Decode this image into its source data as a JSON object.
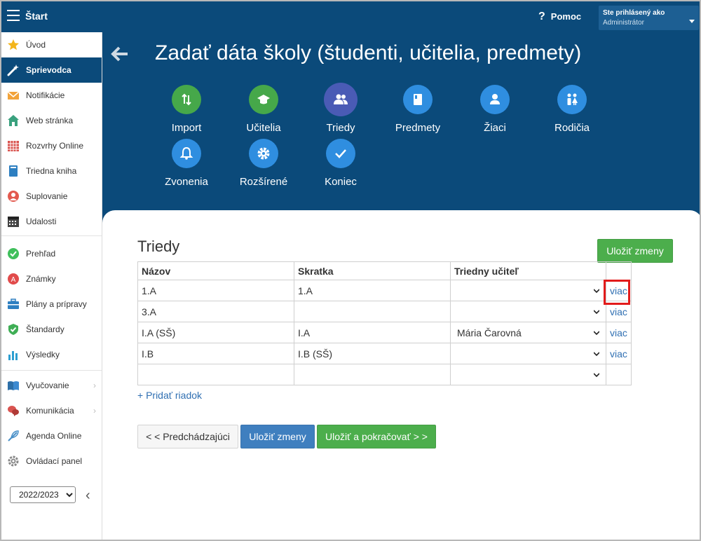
{
  "topbar": {
    "title": "Štart",
    "help_label": "Pomoc",
    "help_icon": "?",
    "user_line1": "Ste prihlásený ako",
    "user_line2": "Administrátor"
  },
  "sidebar": {
    "items": [
      {
        "label": "Úvod",
        "icon": "star-icon"
      },
      {
        "label": "Sprievodca",
        "icon": "magic-wand-icon"
      },
      {
        "label": "Notifikácie",
        "icon": "envelope-icon"
      },
      {
        "label": "Web stránka",
        "icon": "house-icon"
      },
      {
        "label": "Rozvrhy Online",
        "icon": "timetable-icon"
      },
      {
        "label": "Triedna kniha",
        "icon": "book-icon"
      },
      {
        "label": "Suplovanie",
        "icon": "person-icon"
      },
      {
        "label": "Udalosti",
        "icon": "calendar-icon"
      },
      {
        "label": "Prehľad",
        "icon": "check-circle-icon"
      },
      {
        "label": "Známky",
        "icon": "grade-icon"
      },
      {
        "label": "Plány a prípravy",
        "icon": "briefcase-icon"
      },
      {
        "label": "Štandardy",
        "icon": "shield-check-icon"
      },
      {
        "label": "Výsledky",
        "icon": "bar-chart-icon"
      },
      {
        "label": "Vyučovanie",
        "icon": "open-book-icon"
      },
      {
        "label": "Komunikácia",
        "icon": "chat-icon"
      },
      {
        "label": "Agenda Online",
        "icon": "feather-icon"
      },
      {
        "label": "Ovládací panel",
        "icon": "gear-icon"
      }
    ],
    "year": "2022/2023"
  },
  "header": {
    "title": "Zadať dáta školy (študenti, učitelia, predmety)"
  },
  "steps": [
    {
      "label": "Import",
      "icon": "import-arrows-icon"
    },
    {
      "label": "Učitelia",
      "icon": "graduation-cap-icon"
    },
    {
      "label": "Triedy",
      "icon": "group-icon"
    },
    {
      "label": "Predmety",
      "icon": "notebook-icon"
    },
    {
      "label": "Žiaci",
      "icon": "user-icon"
    },
    {
      "label": "Rodičia",
      "icon": "parents-icon"
    },
    {
      "label": "Zvonenia",
      "icon": "bell-icon"
    },
    {
      "label": "Rozšírené",
      "icon": "gear-icon"
    },
    {
      "label": "Koniec",
      "icon": "checkmark-icon"
    }
  ],
  "section": {
    "title": "Triedy",
    "save_top": "Uložiť zmeny",
    "columns": [
      "Názov",
      "Skratka",
      "Triedny učiteľ"
    ],
    "rows": [
      {
        "name": "1.A",
        "abbr": "1.A",
        "teacher": "",
        "more": "viac"
      },
      {
        "name": "3.A",
        "abbr": "",
        "teacher": "",
        "more": "viac"
      },
      {
        "name": "I.A (SŠ)",
        "abbr": "I.A",
        "teacher": "Mária Čarovná",
        "more": "viac"
      },
      {
        "name": "I.B",
        "abbr": "I.B (SŠ)",
        "teacher": "",
        "more": "viac"
      },
      {
        "name": "",
        "abbr": "",
        "teacher": "",
        "more": ""
      }
    ],
    "add_row": "+ Pridať riadok",
    "btn_prev": "< < Predchádzajúci",
    "btn_save": "Uložiť zmeny",
    "btn_save_next": "Uložiť a pokračovať > >"
  },
  "colors": {
    "brand_blue": "#0b4a7a",
    "green": "#4cae4c",
    "blue_button": "#3f7fbf",
    "link": "#2f6fb2",
    "highlight": "#e21b1b"
  }
}
